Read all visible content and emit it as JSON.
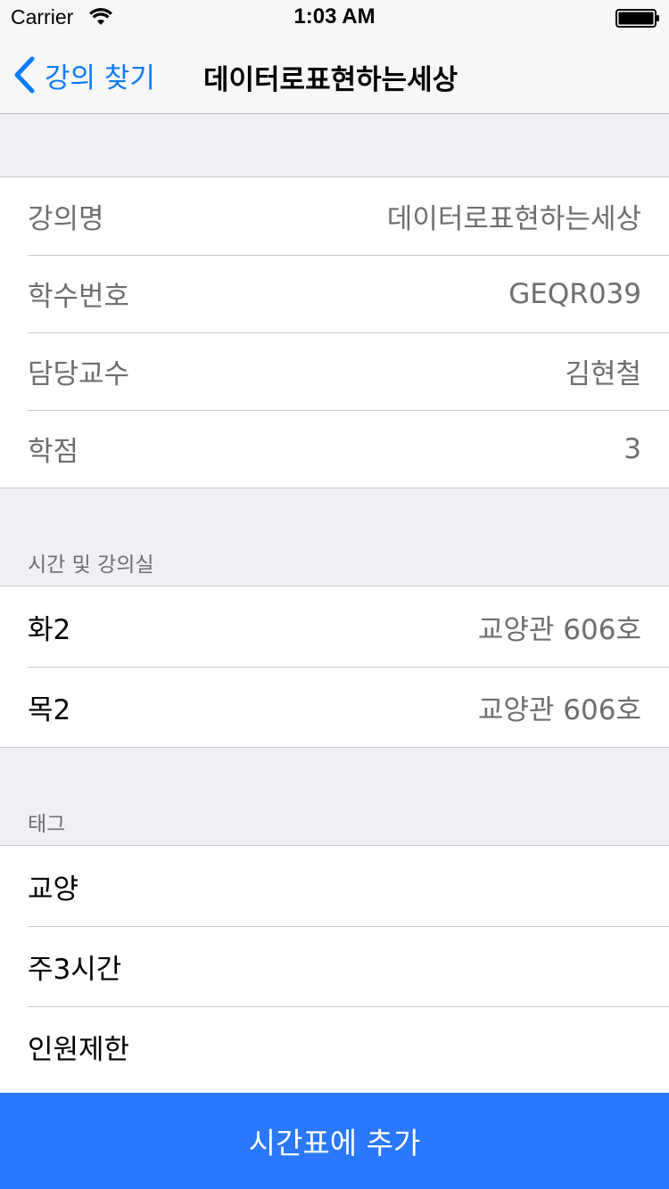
{
  "status_bar": {
    "carrier": "Carrier",
    "time": "1:03 AM"
  },
  "nav": {
    "back_label": "강의 찾기",
    "title": "데이터로표현하는세상"
  },
  "info": {
    "rows": [
      {
        "label": "강의명",
        "value": "데이터로표현하는세상"
      },
      {
        "label": "학수번호",
        "value": "GEQR039"
      },
      {
        "label": "담당교수",
        "value": "김현철"
      },
      {
        "label": "학점",
        "value": "3"
      }
    ]
  },
  "schedule": {
    "header": "시간 및 강의실",
    "rows": [
      {
        "label": "화2",
        "value": "교양관 606호"
      },
      {
        "label": "목2",
        "value": "교양관 606호"
      }
    ]
  },
  "tags": {
    "header": "태그",
    "items": [
      "교양",
      "주3시간",
      "인원제한"
    ]
  },
  "action": {
    "add_label": "시간표에 추가"
  },
  "colors": {
    "accent": "#0b7bff",
    "button": "#2a78fc",
    "background": "#efeff4"
  }
}
